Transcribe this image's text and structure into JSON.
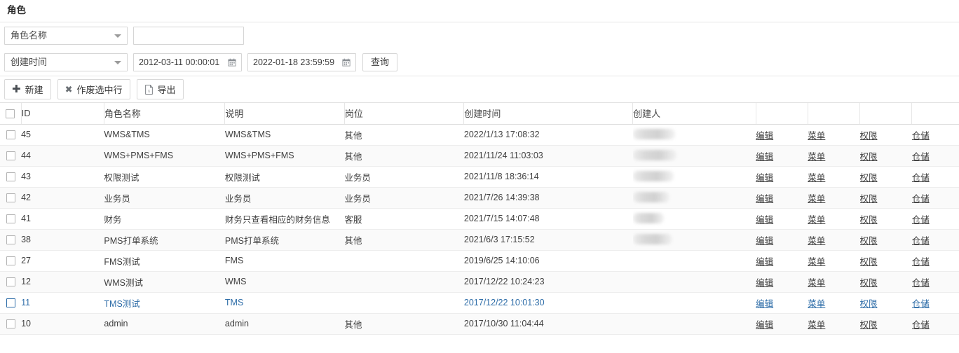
{
  "page": {
    "title": "角色"
  },
  "filters": {
    "row1": {
      "select_label": "角色名称",
      "input_value": "",
      "input_placeholder": ""
    },
    "row2": {
      "select_label": "创建时间",
      "date_from": "2012-03-11 00:00:01",
      "date_to": "2022-01-18 23:59:59",
      "query_label": "查询"
    },
    "icons": {
      "caret": "chevron-down-icon",
      "calendar": "calendar-icon"
    }
  },
  "toolbar": {
    "buttons": [
      {
        "label": "新建",
        "icon": "plus-icon"
      },
      {
        "label": "作废选中行",
        "icon": "close-x-icon"
      },
      {
        "label": "导出",
        "icon": "excel-export-icon"
      }
    ]
  },
  "table": {
    "columns": [
      {
        "key": "check",
        "label": ""
      },
      {
        "key": "id",
        "label": "ID"
      },
      {
        "key": "name",
        "label": "角色名称"
      },
      {
        "key": "desc",
        "label": "说明"
      },
      {
        "key": "post",
        "label": "岗位"
      },
      {
        "key": "time",
        "label": "创建时间"
      },
      {
        "key": "author",
        "label": "创建人"
      },
      {
        "key": "act1",
        "label": ""
      },
      {
        "key": "act2",
        "label": ""
      },
      {
        "key": "act3",
        "label": ""
      },
      {
        "key": "act4",
        "label": ""
      }
    ],
    "actions": [
      "编辑",
      "菜单",
      "权限",
      "仓储"
    ],
    "rows": [
      {
        "id": "45",
        "name": "WMS&TMS",
        "desc": "WMS&TMS",
        "post": "其他",
        "time": "2022/1/13 17:08:32",
        "author_redacted": true,
        "author_blob_width": 60,
        "selected": false
      },
      {
        "id": "44",
        "name": "WMS+PMS+FMS",
        "desc": "WMS+PMS+FMS",
        "post": "其他",
        "time": "2021/11/24 11:03:03",
        "author_redacted": true,
        "author_blob_width": 62,
        "selected": false
      },
      {
        "id": "43",
        "name": "权限测试",
        "desc": "权限测试",
        "post": "业务员",
        "time": "2021/11/8 18:36:14",
        "author_redacted": true,
        "author_blob_width": 58,
        "selected": false
      },
      {
        "id": "42",
        "name": "业务员",
        "desc": "业务员",
        "post": "业务员",
        "time": "2021/7/26 14:39:38",
        "author_redacted": true,
        "author_blob_width": 52,
        "selected": false
      },
      {
        "id": "41",
        "name": "财务",
        "desc": "财务只查看相应的财务信息",
        "post": "客服",
        "time": "2021/7/15 14:07:48",
        "author_redacted": true,
        "author_blob_width": 44,
        "selected": false
      },
      {
        "id": "38",
        "name": "PMS打单系统",
        "desc": "PMS打单系统",
        "post": "其他",
        "time": "2021/6/3 17:15:52",
        "author_redacted": true,
        "author_blob_width": 56,
        "selected": false
      },
      {
        "id": "27",
        "name": "FMS测试",
        "desc": "FMS",
        "post": "",
        "time": "2019/6/25 14:10:06",
        "author_redacted": false,
        "author_blob_width": 0,
        "selected": false
      },
      {
        "id": "12",
        "name": "WMS测试",
        "desc": "WMS",
        "post": "",
        "time": "2017/12/22 10:24:23",
        "author_redacted": false,
        "author_blob_width": 0,
        "selected": false
      },
      {
        "id": "11",
        "name": "TMS测试",
        "desc": "TMS",
        "post": "",
        "time": "2017/12/22 10:01:30",
        "author_redacted": false,
        "author_blob_width": 0,
        "selected": true
      },
      {
        "id": "10",
        "name": "admin",
        "desc": "admin",
        "post": "其他",
        "time": "2017/10/30 11:04:44",
        "author_redacted": false,
        "author_blob_width": 0,
        "selected": false
      }
    ]
  },
  "colors": {
    "accent": "#2e6da8",
    "border": "#e2e2e2",
    "row_stripe": "#fafafa",
    "text": "#3f3f3f"
  }
}
